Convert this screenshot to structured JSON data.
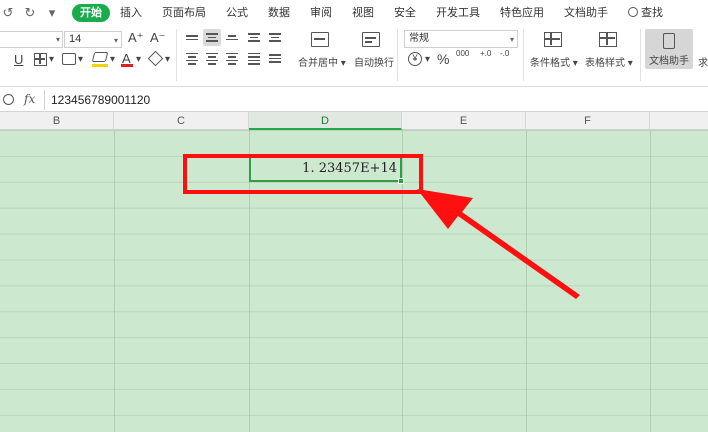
{
  "quick_access": [
    "↺",
    "↻",
    "▾"
  ],
  "menu": {
    "tabs": [
      "开始",
      "插入",
      "页面布局",
      "公式",
      "数据",
      "审阅",
      "视图",
      "安全",
      "开发工具",
      "特色应用",
      "文档助手",
      "查找"
    ],
    "active_tab": "开始"
  },
  "ribbon": {
    "font_size": "14",
    "grow_font": "A⁺",
    "shrink_font": "A⁻",
    "underline": "U",
    "merge_label": "合并居中",
    "wrap_label": "自动换行",
    "number_format": "常规",
    "currency": "¥",
    "percent": "%",
    "thousands": "000",
    "inc_decimal": "+.0",
    "dec_decimal": "-.0",
    "cond_format_label": "条件格式",
    "table_style_label": "表格样式",
    "doc_helper_label": "文档助手",
    "extra_label": "求"
  },
  "formula_bar": {
    "fx": "fx",
    "value": "123456789001120"
  },
  "columns": [
    "B",
    "C",
    "D",
    "E",
    "F"
  ],
  "selected_column": "D",
  "cell": {
    "display": "1. 23457E+14"
  },
  "colors": {
    "accent": "#1aab4d",
    "sheet_bg": "#cce8cf",
    "highlight": "#ff1010",
    "selection": "#2f9e44"
  }
}
